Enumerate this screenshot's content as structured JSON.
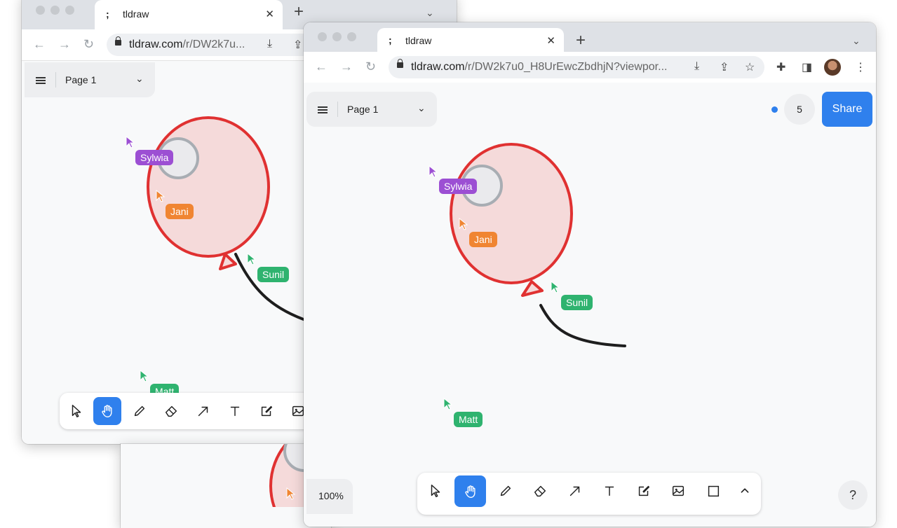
{
  "colors": {
    "accent": "#2f80ed",
    "balloon_stroke": "#e03131",
    "balloon_fill": "#f5dada",
    "sylwia": "#9c4fd3",
    "jani": "#f08532",
    "sunil": "#2fb36f",
    "matt": "#2fb36f"
  },
  "back_window": {
    "tab_title": "tldraw",
    "tab_favicon": ";",
    "url_domain": "tldraw.com",
    "url_path": "/r/DW2k7u...",
    "page_name": "Page 1",
    "collaborators": [
      {
        "name": "Sylwia",
        "color": "purple"
      },
      {
        "name": "Jani",
        "color": "orange"
      },
      {
        "name": "Sunil",
        "color": "green"
      },
      {
        "name": "Matt",
        "color": "green"
      }
    ]
  },
  "front_window": {
    "tab_title": "tldraw",
    "tab_favicon": ";",
    "url_domain": "tldraw.com",
    "url_path": "/r/DW2k7u0_H8UrEwcZbdhjN?viewpor...",
    "page_name": "Page 1",
    "people_count": "5",
    "share_label": "Share",
    "zoom_label": "100%",
    "help_label": "?",
    "collaborators": [
      {
        "name": "Sylwia",
        "color": "purple"
      },
      {
        "name": "Jani",
        "color": "orange"
      },
      {
        "name": "Sunil",
        "color": "green"
      },
      {
        "name": "Matt",
        "color": "green"
      }
    ],
    "tools": [
      "select",
      "hand",
      "draw",
      "eraser",
      "arrow",
      "text",
      "note",
      "image",
      "rectangle",
      "more"
    ],
    "active_tool": "hand"
  }
}
